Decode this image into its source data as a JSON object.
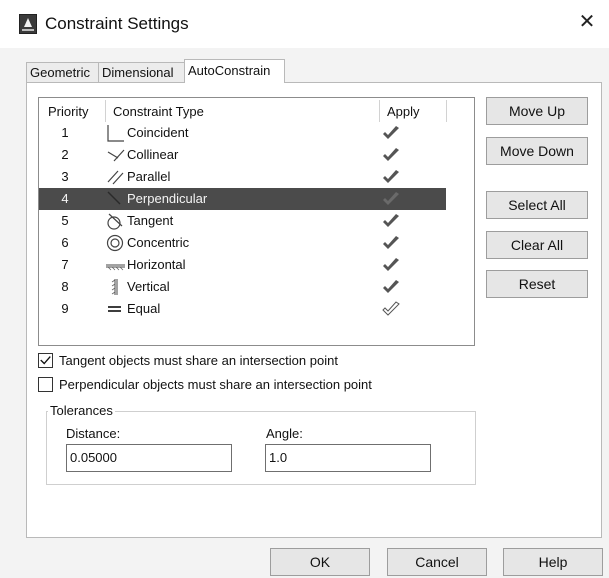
{
  "window": {
    "title": "Constraint Settings",
    "app_icon": "autocad-app-icon",
    "close_icon": "close-icon"
  },
  "tabs": [
    {
      "label": "Geometric",
      "active": false
    },
    {
      "label": "Dimensional",
      "active": false
    },
    {
      "label": "AutoConstrain",
      "active": true
    }
  ],
  "table": {
    "headers": {
      "priority": "Priority",
      "type": "Constraint Type",
      "apply": "Apply"
    },
    "rows": [
      {
        "priority": "1",
        "type": "Coincident",
        "icon": "coincident-icon",
        "apply": true,
        "selected": false
      },
      {
        "priority": "2",
        "type": "Collinear",
        "icon": "collinear-icon",
        "apply": true,
        "selected": false
      },
      {
        "priority": "3",
        "type": "Parallel",
        "icon": "parallel-icon",
        "apply": true,
        "selected": false
      },
      {
        "priority": "4",
        "type": "Perpendicular",
        "icon": "perpendicular-icon",
        "apply": true,
        "selected": true
      },
      {
        "priority": "5",
        "type": "Tangent",
        "icon": "tangent-icon",
        "apply": true,
        "selected": false
      },
      {
        "priority": "6",
        "type": "Concentric",
        "icon": "concentric-icon",
        "apply": true,
        "selected": false
      },
      {
        "priority": "7",
        "type": "Horizontal",
        "icon": "horizontal-icon",
        "apply": true,
        "selected": false
      },
      {
        "priority": "8",
        "type": "Vertical",
        "icon": "vertical-icon",
        "apply": true,
        "selected": false
      },
      {
        "priority": "9",
        "type": "Equal",
        "icon": "equal-icon",
        "apply": false,
        "selected": false
      }
    ]
  },
  "side_buttons": {
    "move_up": "Move Up",
    "move_down": "Move Down",
    "select_all": "Select All",
    "clear_all": "Clear All",
    "reset": "Reset"
  },
  "options": [
    {
      "label": "Tangent objects must share an intersection point",
      "checked": true
    },
    {
      "label": "Perpendicular objects must share an intersection point",
      "checked": false
    }
  ],
  "tolerances": {
    "title": "Tolerances",
    "distance_label": "Distance:",
    "distance_value": "0.05000",
    "angle_label": "Angle:",
    "angle_value": "1.0"
  },
  "footer": {
    "ok": "OK",
    "cancel": "Cancel",
    "help": "Help"
  },
  "colors": {
    "selected_row": "#4b4b4b",
    "check_mark": "#555555",
    "dialog_bg": "#f3f3f3"
  }
}
